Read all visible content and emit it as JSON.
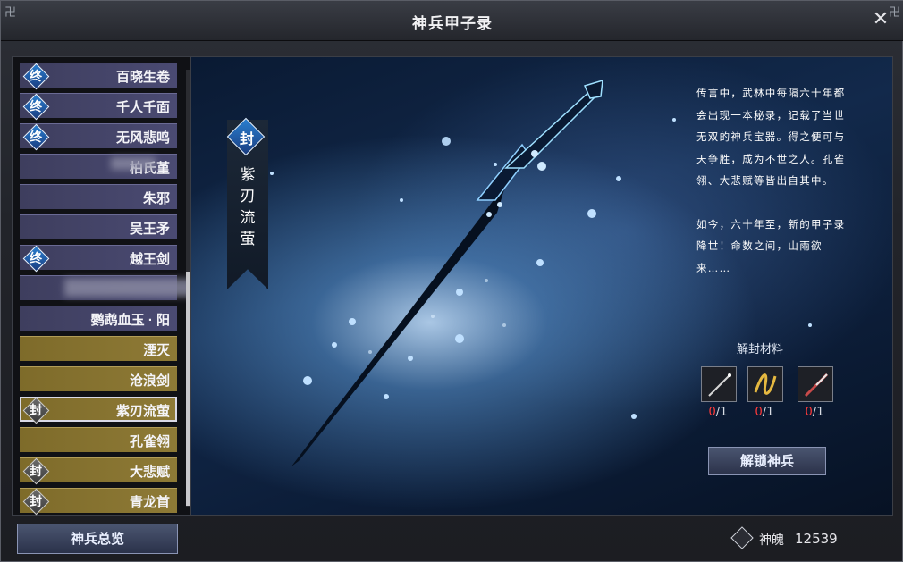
{
  "window": {
    "title": "神兵甲子录",
    "close_icon": "close-icon",
    "corner_glyph": "卍"
  },
  "weapon_list": [
    {
      "label": "百晓生卷",
      "badge": "终",
      "style": "normal"
    },
    {
      "label": "千人千面",
      "badge": "终",
      "style": "normal"
    },
    {
      "label": "无风悲鸣",
      "badge": "终",
      "style": "normal"
    },
    {
      "label": "柏氏堇",
      "badge": "",
      "style": "normal"
    },
    {
      "label": "朱邪",
      "badge": "",
      "style": "normal"
    },
    {
      "label": "吴王矛",
      "badge": "",
      "style": "normal"
    },
    {
      "label": "越王剑",
      "badge": "终",
      "style": "normal"
    },
    {
      "label": "",
      "badge": "",
      "style": "normal"
    },
    {
      "label": "鹦鹉血玉 · 阳",
      "badge": "",
      "style": "normal"
    },
    {
      "label": "湮灭",
      "badge": "",
      "style": "gold"
    },
    {
      "label": "沧浪剑",
      "badge": "",
      "style": "gold"
    },
    {
      "label": "紫刃流萤",
      "badge": "封",
      "style": "gold",
      "selected": true
    },
    {
      "label": "孔雀翎",
      "badge": "",
      "style": "gold"
    },
    {
      "label": "大悲赋",
      "badge": "封",
      "style": "gold"
    },
    {
      "label": "青龙首",
      "badge": "封",
      "style": "gold"
    }
  ],
  "selected_weapon": {
    "status_badge": "封",
    "name_chars": [
      "紫",
      "刃",
      "流",
      "萤"
    ]
  },
  "lore": {
    "paragraph1": "传言中，武林中每隔六十年都会出现一本秘录，记载了当世无双的神兵宝器。得之便可与天争胜，成为不世之人。孔雀翎、大悲赋等皆出自其中。",
    "paragraph2": "如今，六十年至，新的甲子录降世！命数之间，山雨欲来……"
  },
  "materials": {
    "title": "解封材料",
    "items": [
      {
        "icon": "needle-icon",
        "have": "0",
        "need": "1"
      },
      {
        "icon": "golden-ribbon-icon",
        "have": "0",
        "need": "1"
      },
      {
        "icon": "red-blade-icon",
        "have": "0",
        "need": "1"
      }
    ]
  },
  "unlock_button": "解锁神兵",
  "overview_button": "神兵总览",
  "currency": {
    "icon": "spirit-soul-icon",
    "label": "神魄",
    "value": "12539"
  },
  "colors": {
    "list_normal": "#45456a",
    "list_gold": "#8a7632",
    "badge_blue": "#2a7fd0",
    "count_red": "#ff3b3b"
  }
}
